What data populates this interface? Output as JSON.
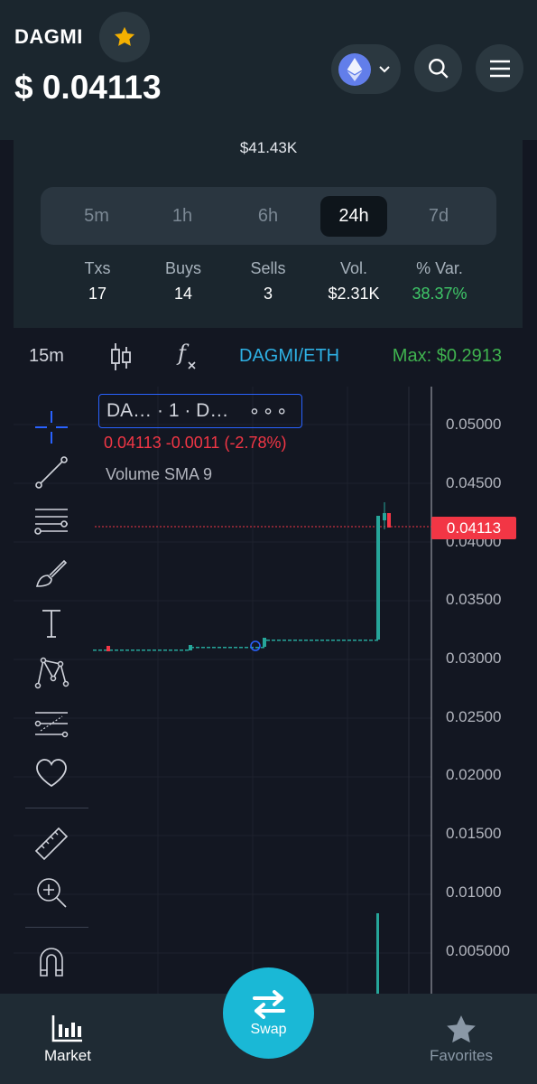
{
  "header": {
    "token_name": "DAGMI",
    "price": "$ 0.04113",
    "chain_icon": "ethereum-icon",
    "favorite_icon": "star-icon",
    "accent_color": "#f4b000"
  },
  "panel": {
    "liquidity": "$41.43K",
    "timeframes": [
      "5m",
      "1h",
      "6h",
      "24h",
      "7d"
    ],
    "active_timeframe": "24h",
    "stats": [
      {
        "label": "Txs",
        "value": "17"
      },
      {
        "label": "Buys",
        "value": "14"
      },
      {
        "label": "Sells",
        "value": "3"
      },
      {
        "label": "Vol.",
        "value": "$2.31K"
      },
      {
        "label": "% Var.",
        "value": "38.37%"
      }
    ],
    "positive_color": "#3fc768"
  },
  "chart_toolbar": {
    "interval": "15m",
    "pair": "DAGMI/ETH",
    "max": "Max: $0.2913"
  },
  "chart": {
    "legend_title": "DA…  · 1 · D…",
    "legend_more": "∘∘∘",
    "legend_values": "0.04113  -0.0011  (-2.78%)",
    "indicator": "Volume SMA 9",
    "current_price": "0.04113",
    "axis_ticks": [
      "0.05000",
      "0.04500",
      "0.04000",
      "0.03500",
      "0.03000",
      "0.02500",
      "0.02000",
      "0.01500",
      "0.01000",
      "0.005000"
    ],
    "up_color": "#26a69a",
    "down_color": "#f23645"
  },
  "nav": {
    "market": "Market",
    "swap": "Swap",
    "favorites": "Favorites"
  }
}
